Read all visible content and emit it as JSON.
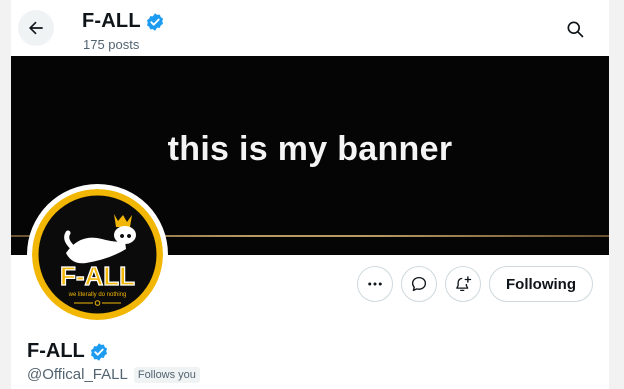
{
  "header": {
    "title": "F-ALL",
    "posts_count": "175 posts",
    "back_icon": "arrow-left-icon",
    "search_icon": "search-icon"
  },
  "banner": {
    "text": "this is my banner",
    "background": "#050505",
    "accent_line_color": "#b89a64"
  },
  "avatar": {
    "logo_text": "F-ALL",
    "tagline": "we literally do nothing",
    "ring_color": "#f2b705"
  },
  "actions": {
    "more_icon": "more-horizontal-icon",
    "message_icon": "message-icon",
    "notify_icon": "notification-add-icon",
    "following_label": "Following"
  },
  "profile": {
    "display_name": "F-ALL",
    "handle": "@Offical_FALL",
    "follows_you": "Follows you",
    "verified_color": "#1d9bf0"
  }
}
